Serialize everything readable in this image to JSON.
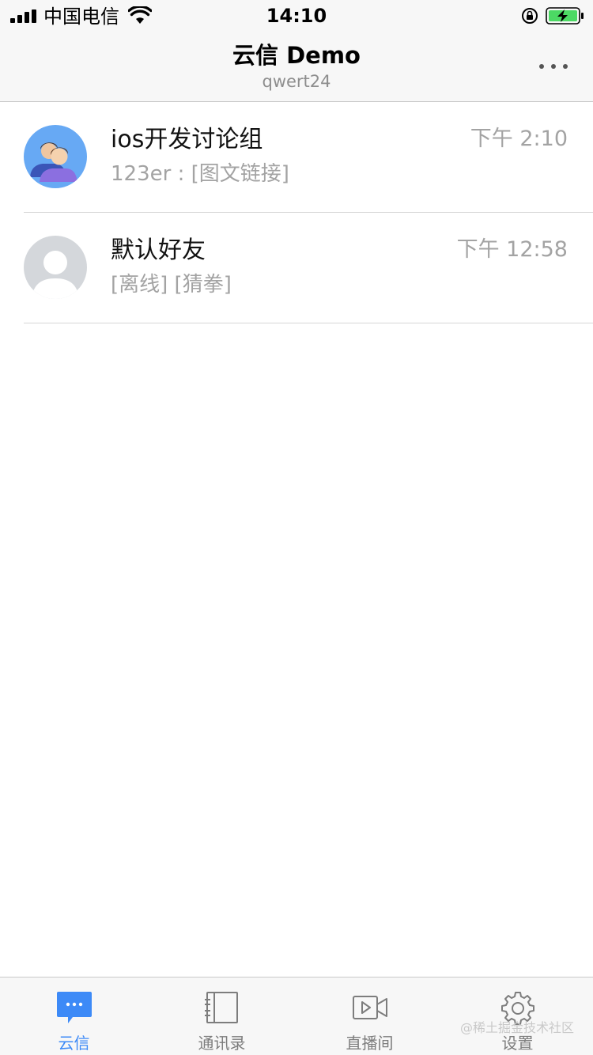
{
  "status_bar": {
    "carrier": "中国电信",
    "time": "14:10",
    "icons": [
      "signal-icon",
      "wifi-icon",
      "orientation-lock-icon",
      "battery-charging-icon"
    ]
  },
  "nav": {
    "title": "云信 Demo",
    "subtitle": "qwert24",
    "more_icon": "more-dots-icon"
  },
  "sessions": [
    {
      "name": "ios开发讨论组",
      "message": "123er : [图文链接]",
      "time": "下午 2:10",
      "avatar": "group-avatar-icon"
    },
    {
      "name": "默认好友",
      "message": "[离线] [猜拳]",
      "time": "下午 12:58",
      "avatar": "default-user-avatar-icon"
    }
  ],
  "tabs": [
    {
      "label": "云信",
      "icon": "chat-bubble-icon",
      "active": true
    },
    {
      "label": "通讯录",
      "icon": "contacts-book-icon",
      "active": false
    },
    {
      "label": "直播间",
      "icon": "video-camera-icon",
      "active": false
    },
    {
      "label": "设置",
      "icon": "gear-icon",
      "active": false
    }
  ],
  "watermark": "@稀土掘金技术社区",
  "colors": {
    "accent": "#3d8af7",
    "bar_background": "#f7f7f7",
    "secondary_text": "#a3a3a3",
    "battery_green": "#4cd964"
  }
}
